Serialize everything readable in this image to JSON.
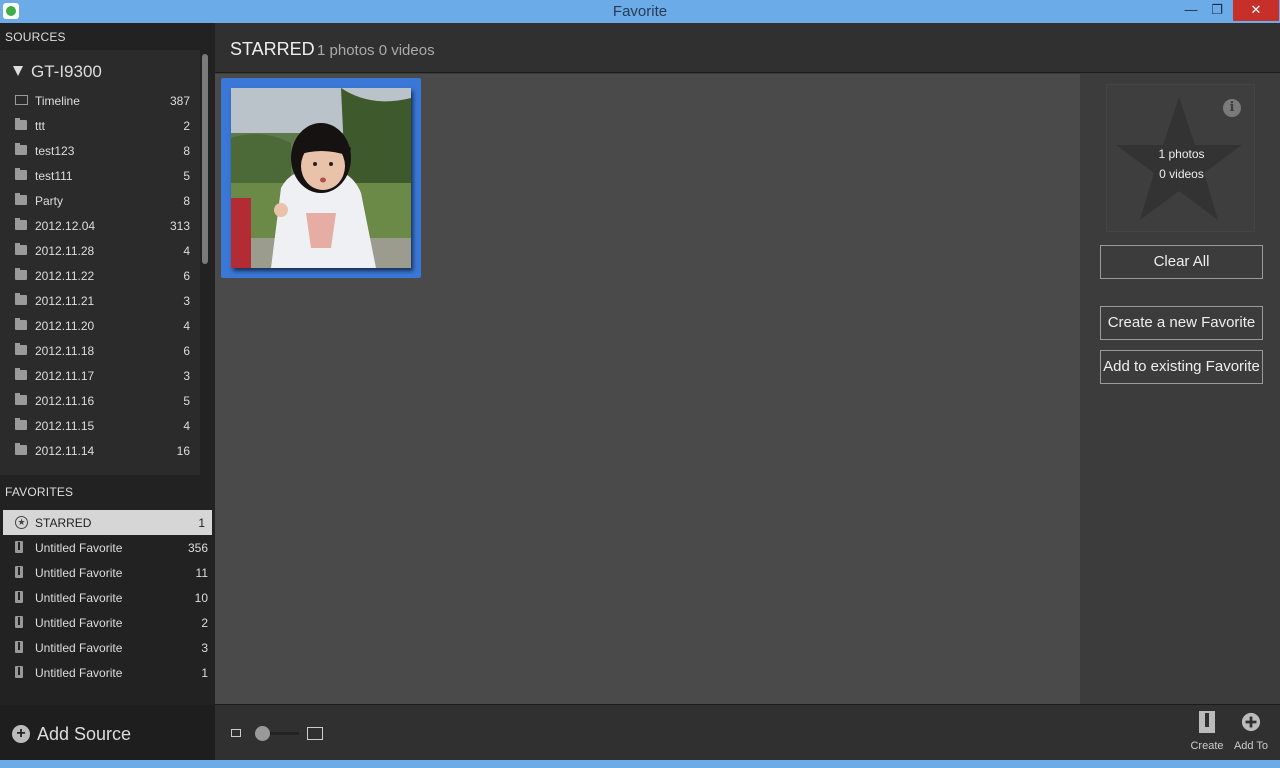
{
  "window": {
    "title": "Favorite",
    "minimize_icon": "minimize-icon",
    "maximize_icon": "restore-icon",
    "close_label": "✕",
    "minimize_label": "—",
    "restore_label": "❐"
  },
  "sidebar": {
    "sources_header": "SOURCES",
    "device": "GT-I9300",
    "sources": [
      {
        "label": "Timeline",
        "count": "387",
        "icon": "timeline-icon"
      },
      {
        "label": "ttt",
        "count": "2",
        "icon": "folder-icon"
      },
      {
        "label": "test123",
        "count": "8",
        "icon": "folder-icon"
      },
      {
        "label": "test111",
        "count": "5",
        "icon": "folder-icon"
      },
      {
        "label": "Party",
        "count": "8",
        "icon": "folder-icon"
      },
      {
        "label": "2012.12.04",
        "count": "313",
        "icon": "folder-icon"
      },
      {
        "label": "2012.11.28",
        "count": "4",
        "icon": "folder-icon"
      },
      {
        "label": "2012.11.22",
        "count": "6",
        "icon": "folder-icon"
      },
      {
        "label": "2012.11.21",
        "count": "3",
        "icon": "folder-icon"
      },
      {
        "label": "2012.11.20",
        "count": "4",
        "icon": "folder-icon"
      },
      {
        "label": "2012.11.18",
        "count": "6",
        "icon": "folder-icon"
      },
      {
        "label": "2012.11.17",
        "count": "3",
        "icon": "folder-icon"
      },
      {
        "label": "2012.11.16",
        "count": "5",
        "icon": "folder-icon"
      },
      {
        "label": "2012.11.15",
        "count": "4",
        "icon": "folder-icon"
      },
      {
        "label": "2012.11.14",
        "count": "16",
        "icon": "folder-icon"
      }
    ],
    "favorites_header": "FAVORITES",
    "favorites": [
      {
        "label": "STARRED",
        "count": "1",
        "icon": "star-icon",
        "selected": true
      },
      {
        "label": "Untitled Favorite",
        "count": "356",
        "icon": "book-icon"
      },
      {
        "label": "Untitled Favorite",
        "count": "11",
        "icon": "book-icon"
      },
      {
        "label": "Untitled Favorite",
        "count": "10",
        "icon": "book-icon"
      },
      {
        "label": "Untitled Favorite",
        "count": "2",
        "icon": "book-icon"
      },
      {
        "label": "Untitled Favorite",
        "count": "3",
        "icon": "book-icon"
      },
      {
        "label": "Untitled Favorite",
        "count": "1",
        "icon": "book-icon"
      }
    ],
    "add_source_label": "Add Source"
  },
  "main": {
    "title": "STARRED",
    "subtitle": "1 photos 0 videos"
  },
  "panel": {
    "photos": "1 photos",
    "videos": "0 videos",
    "info_label": "i",
    "clear_all": "Clear All",
    "create_new": "Create a new Favorite",
    "add_existing": "Add to existing Favorite"
  },
  "bottom": {
    "create_label": "Create",
    "add_to_label": "Add To"
  },
  "colors": {
    "accent": "#3a77d6",
    "titlebar": "#6aabe8",
    "close": "#c7302a"
  }
}
